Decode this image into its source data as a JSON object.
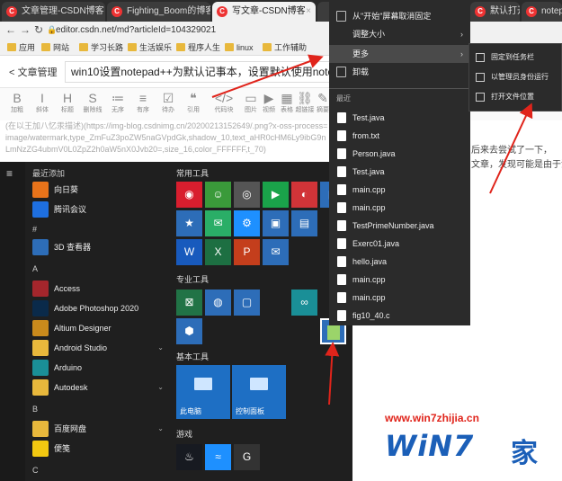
{
  "tabs": [
    {
      "label": "文章管理-CSDN博客",
      "active": false
    },
    {
      "label": "Fighting_Boom的博客",
      "active": false
    },
    {
      "label": "写文章-CSDN博客",
      "active": true
    },
    {
      "label": "",
      "active": false
    },
    {
      "label": "默认打开",
      "active": false
    },
    {
      "label": "notepad",
      "active": false
    }
  ],
  "address": {
    "url": "editor.csdn.net/md?articleId=104329021"
  },
  "bookmarks": [
    "应用",
    "网站",
    "学习长路",
    "生活娱乐",
    "程序人生",
    "linux",
    "工作辅助"
  ],
  "editor": {
    "back_label": "文章管理",
    "title": "win10设置notepad++为默认记事本，设置默认使用notepad+"
  },
  "toolbar": [
    {
      "glyph": "B",
      "label": "加粗"
    },
    {
      "glyph": "I",
      "label": "斜体"
    },
    {
      "glyph": "H",
      "label": "标题"
    },
    {
      "glyph": "S",
      "label": "删除线"
    },
    {
      "glyph": "≔",
      "label": "无序"
    },
    {
      "glyph": "≡",
      "label": "有序"
    },
    {
      "glyph": "☑",
      "label": "待办"
    },
    {
      "glyph": "❝",
      "label": "引用"
    },
    {
      "glyph": "</>",
      "label": "代码块"
    },
    {
      "glyph": "▭",
      "label": "图片"
    },
    {
      "glyph": "▶",
      "label": "视频"
    },
    {
      "glyph": "▦",
      "label": "表格"
    },
    {
      "glyph": "⛓",
      "label": "超链接"
    },
    {
      "glyph": "✎",
      "label": "摘要"
    }
  ],
  "markdown_text": "(在以王加八忆汞描述)(https://img-blog.csdnimg.cn/20200213152649/.png?x-oss-process=image/watermark,type_ZmFuZ3poZW5naGVpdGk,shadow_10,text_aHR0cHM6Ly9ibG9nLmNzZG4ubmV0L0ZpZ2h0aW5nX0Jvb20=,size_16,color_FFFFFF,t_70)",
  "right_text": [
    "后来去尝试了一下，",
    "文章，发现可能是由于没"
  ],
  "start_menu": {
    "recent_header": "最近添加",
    "recent_apps": [
      {
        "name": "向日葵",
        "color": "#e8731a"
      },
      {
        "name": "腾讯会议",
        "color": "#1e6fe0"
      }
    ],
    "groups": [
      {
        "letter": "#",
        "apps": [
          {
            "name": "3D 查看器",
            "color": "#2d6db8",
            "chev": false
          }
        ]
      },
      {
        "letter": "A",
        "apps": [
          {
            "name": "Access",
            "color": "#a4262c",
            "chev": false
          },
          {
            "name": "Adobe Photoshop 2020",
            "color": "#0a2a4a",
            "chev": false
          },
          {
            "name": "Altium Designer",
            "color": "#c98a1c",
            "chev": false
          },
          {
            "name": "Android Studio",
            "color": "#e8b83c",
            "chev": true
          },
          {
            "name": "Arduino",
            "color": "#1a8f97",
            "chev": false
          },
          {
            "name": "Autodesk",
            "color": "#e8b83c",
            "chev": true
          }
        ]
      },
      {
        "letter": "B",
        "apps": [
          {
            "name": "百度网盘",
            "color": "#e8b83c",
            "chev": true
          },
          {
            "name": "便笺",
            "color": "#f2c811",
            "chev": false
          }
        ]
      },
      {
        "letter": "C",
        "apps": []
      }
    ],
    "tile_groups": [
      {
        "label": "常用工具"
      },
      {
        "label": "专业工具"
      },
      {
        "label": "基本工具"
      },
      {
        "label": "游戏"
      }
    ],
    "basic_tiles": [
      {
        "label": "此电脑"
      },
      {
        "label": "控制面板"
      }
    ]
  },
  "context_menu": {
    "items": [
      {
        "label": "从\"开始\"屏幕取消固定",
        "arrow": false
      },
      {
        "label": "调整大小",
        "arrow": true
      },
      {
        "label": "更多",
        "arrow": true
      },
      {
        "label": "卸载",
        "arrow": false
      }
    ],
    "recent_header": "最近",
    "recent_files": [
      "Test.java",
      "from.txt",
      "Person.java",
      "Test.java",
      "main.cpp",
      "main.cpp",
      "TestPrimeNumber.java",
      "Exerc01.java",
      "hello.java",
      "main.cpp",
      "main.cpp",
      "fig10_40.c"
    ]
  },
  "submenu": {
    "items": [
      "固定到任务栏",
      "以管理员身份运行",
      "打开文件位置"
    ]
  },
  "watermark": {
    "site": "www.win7zhijia.cn",
    "logo": "WiN7",
    "logo_suffix": "家"
  },
  "colors": {
    "accent": "#2d6db8",
    "menu_bg": "#2b2b2b",
    "arrow": "#e0241b"
  }
}
